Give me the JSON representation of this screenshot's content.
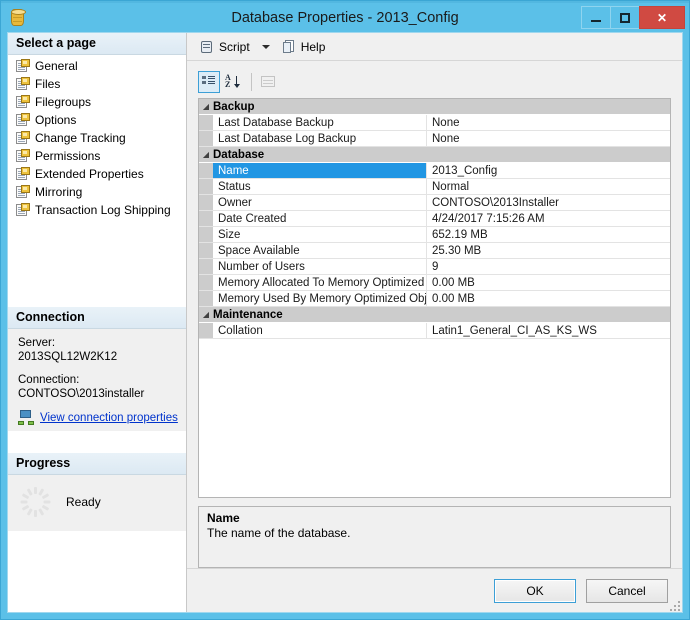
{
  "window": {
    "title": "Database Properties - 2013_Config",
    "icon": "database-icon",
    "minimize_label": "Minimize",
    "maximize_label": "Maximize",
    "close_label": "Close"
  },
  "toolbar": {
    "script_label": "Script",
    "script_icon": "script-icon",
    "script_dropdown_icon": "chevron-down-icon",
    "help_label": "Help",
    "help_icon": "help-icon"
  },
  "sidebar": {
    "pages_header": "Select a page",
    "pages": [
      {
        "label": "General"
      },
      {
        "label": "Files"
      },
      {
        "label": "Filegroups"
      },
      {
        "label": "Options"
      },
      {
        "label": "Change Tracking"
      },
      {
        "label": "Permissions"
      },
      {
        "label": "Extended Properties"
      },
      {
        "label": "Mirroring"
      },
      {
        "label": "Transaction Log Shipping"
      }
    ],
    "connection_header": "Connection",
    "connection": {
      "server_label": "Server:",
      "server_value": "2013SQL12W2K12",
      "connection_label": "Connection:",
      "connection_value": "CONTOSO\\2013installer",
      "link_label": "View connection properties",
      "link_icon": "network-connection-icon"
    },
    "progress_header": "Progress",
    "progress": {
      "status": "Ready",
      "spinner_icon": "progress-spinner-icon"
    }
  },
  "grid_toolbar": {
    "categorized_label": "Categorized",
    "categorized_icon": "categorized-view-icon",
    "alphabetical_label": "Alphabetical",
    "alphabetical_icon": "sort-alphabetical-icon",
    "property_pages_label": "Property Pages",
    "property_pages_icon": "property-pages-icon"
  },
  "grid": {
    "categories": [
      {
        "name": "Backup",
        "collapse_icon": "triangle-expanded-icon",
        "rows": [
          {
            "name": "Last Database Backup",
            "value": "None",
            "selected": false
          },
          {
            "name": "Last Database Log Backup",
            "value": "None",
            "selected": false
          }
        ]
      },
      {
        "name": "Database",
        "collapse_icon": "triangle-expanded-icon",
        "rows": [
          {
            "name": "Name",
            "value": "2013_Config",
            "selected": true
          },
          {
            "name": "Status",
            "value": "Normal",
            "selected": false
          },
          {
            "name": "Owner",
            "value": "CONTOSO\\2013Installer",
            "selected": false
          },
          {
            "name": "Date Created",
            "value": "4/24/2017 7:15:26 AM",
            "selected": false
          },
          {
            "name": "Size",
            "value": "652.19 MB",
            "selected": false
          },
          {
            "name": "Space Available",
            "value": "25.30 MB",
            "selected": false
          },
          {
            "name": "Number of Users",
            "value": "9",
            "selected": false
          },
          {
            "name": "Memory Allocated To Memory Optimized Obj",
            "value": "0.00 MB",
            "selected": false
          },
          {
            "name": "Memory Used By Memory Optimized Objects",
            "value": "0.00 MB",
            "selected": false
          }
        ]
      },
      {
        "name": "Maintenance",
        "collapse_icon": "triangle-expanded-icon",
        "rows": [
          {
            "name": "Collation",
            "value": "Latin1_General_CI_AS_KS_WS",
            "selected": false
          }
        ]
      }
    ]
  },
  "description": {
    "title": "Name",
    "text": "The name of the database."
  },
  "footer": {
    "ok_label": "OK",
    "cancel_label": "Cancel"
  },
  "colors": {
    "title_bar": "#5bc0e8",
    "close_button": "#d04a42",
    "selection": "#2196e3",
    "link": "#0033cc",
    "category_row": "#cccccc"
  }
}
